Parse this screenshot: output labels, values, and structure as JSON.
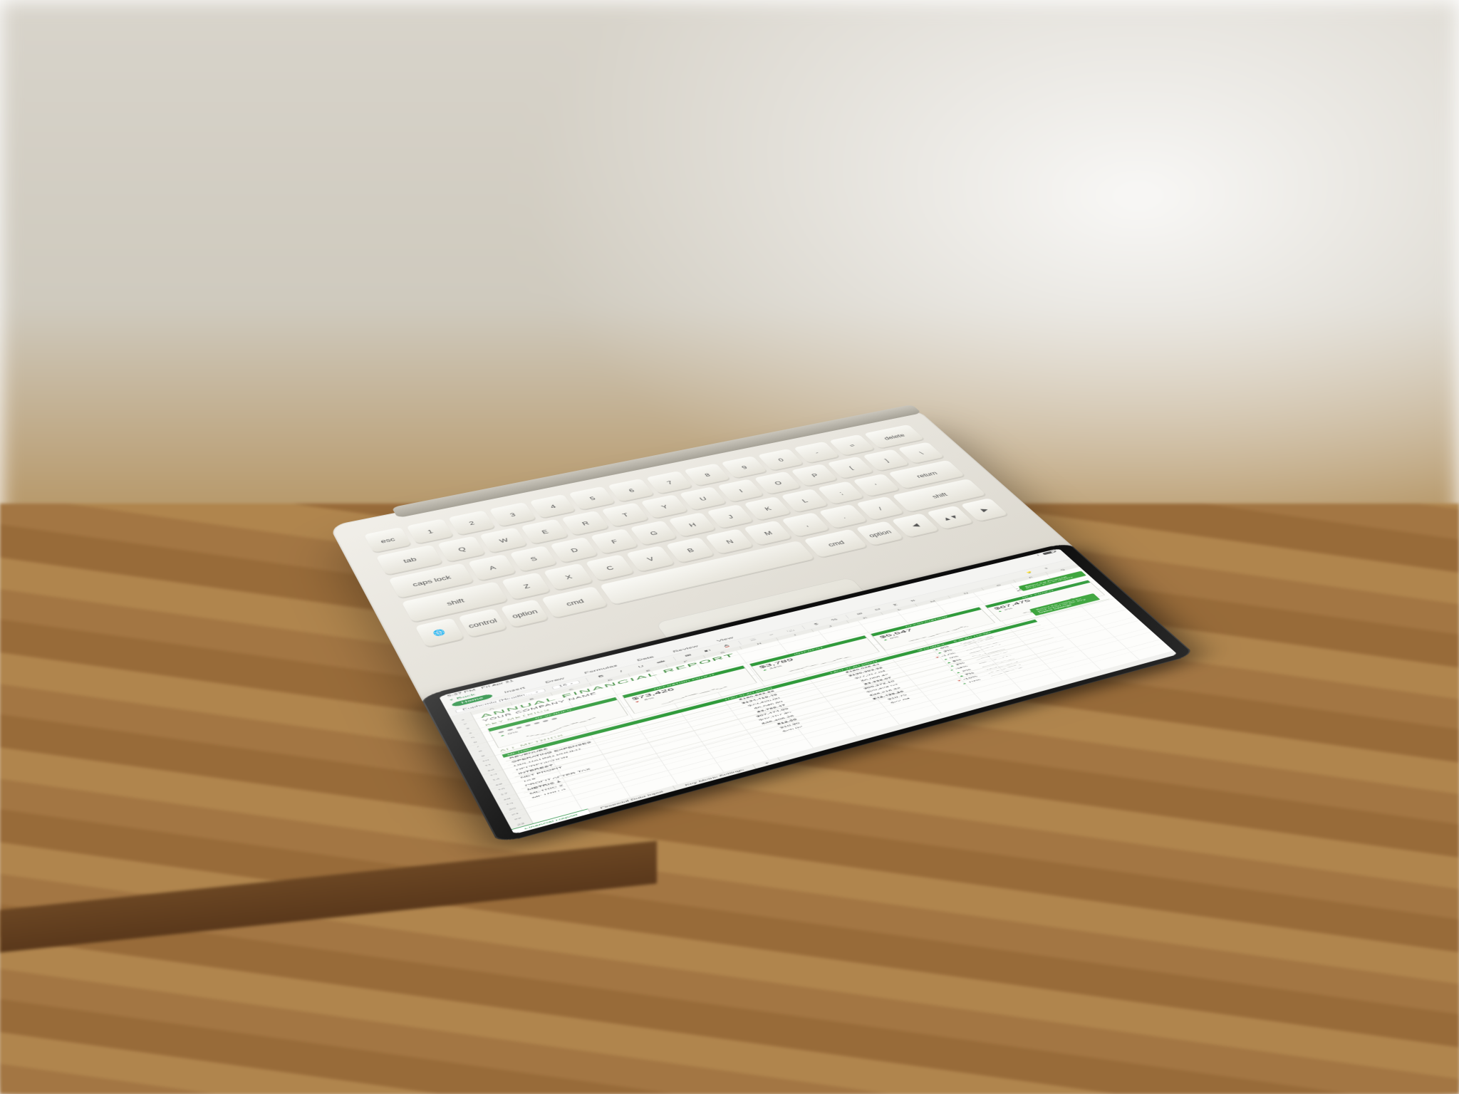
{
  "status": {
    "time": "5:37 PM",
    "date": "Fri Apr 21"
  },
  "titlebar": {
    "back": "Back"
  },
  "ribbon": {
    "tabs": [
      "Home",
      "Insert",
      "Draw",
      "Formulas",
      "Data",
      "Review",
      "View"
    ],
    "active": 0,
    "font_name": "Euphemia (Headin…",
    "font_size": "16"
  },
  "columns": [
    "A",
    "B",
    "C",
    "D",
    "E",
    "F",
    "G",
    "H",
    "I",
    "J",
    "K",
    "L",
    "M",
    "N",
    "O",
    "P",
    "Q"
  ],
  "report": {
    "title": "ANNUAL FINANCIAL REPORT",
    "company": "YOUR COMPANY NAME",
    "year": "2022",
    "section_key_metrics": "KEY METRICS",
    "section_all_metrics": "ALL METRICS",
    "callout_year": "Select the Financial Report year to display",
    "callout_metrics": "Select the metrics for your report on the Key Metric Settings"
  },
  "cards": [
    {
      "label": "REVENUES",
      "value": "●●●●●●●",
      "delta": "0%",
      "dir": "up",
      "dots": true
    },
    {
      "label": "OPERATING PROFIT",
      "value": "$73,426",
      "delta": "-6%",
      "dir": "down",
      "dots": false
    },
    {
      "label": "INTEREST",
      "value": "$3,789",
      "delta": "34%",
      "dir": "up",
      "dots": false
    },
    {
      "label": "DEPRECIATION",
      "value": "$5,547",
      "delta": "9%",
      "dir": "up",
      "dots": false
    },
    {
      "label": "NET PROFIT",
      "value": "$67,475",
      "delta": "2%",
      "dir": "up",
      "dots": false
    }
  ],
  "table": {
    "headers": {
      "metric": "METRIC",
      "this_year": "THIS YEAR (2022)",
      "last_year": "LAST YEAR (2021)",
      "pct": "% CHANGE",
      "trend": "5 YEAR TREND"
    },
    "rows": [
      {
        "metric": "REVENUES",
        "ty": "$180,583.88",
        "ly": "$180,026.64",
        "pct": "0%",
        "dir": "up"
      },
      {
        "metric": "OPERATING EXPENSES",
        "ty": "$134,415.46",
        "ly": "$130,383.32",
        "pct": "3%",
        "dir": "up"
      },
      {
        "metric": "OPERATING PROFIT",
        "ty": "$73,426.00",
        "ly": "$77,317.84",
        "pct": "-17%",
        "dir": "down"
      },
      {
        "metric": "DEPRECIATION",
        "ty": "$5,546.89",
        "ly": "$5,068.42",
        "pct": "9%",
        "dir": "up"
      },
      {
        "metric": "INTEREST",
        "ty": "$3,789.47",
        "ly": "$3,338.07",
        "pct": "5%",
        "dir": "up"
      },
      {
        "metric": "NET PROFIT",
        "ty": "$67,474.85",
        "ly": "$66,272.10",
        "pct": "2%",
        "dir": "up"
      },
      {
        "metric": "TAX",
        "ty": "$32,167.45",
        "ly": "$29,424.53",
        "pct": "34%",
        "dir": "up"
      },
      {
        "metric": "PROFIT AFTER TAX",
        "ty": "$35,406.26",
        "ly": "$48,216.32",
        "pct": "2%",
        "dir": "up"
      },
      {
        "metric": "METRIC 1",
        "ty": "$12.00",
        "ly": "$42,438.20",
        "pct": "7%",
        "dir": "up"
      },
      {
        "metric": "METRIC 2",
        "ty": "$18.96",
        "ly": "$18.75",
        "pct": "-16%",
        "dir": "down"
      },
      {
        "metric": "METRIC 3",
        "ty": "$26.02",
        "ly": "$22.84",
        "pct": "19%",
        "dir": "up"
      }
    ]
  },
  "sheet_tabs": [
    "Financial Report",
    "Financial Data Input",
    "Key Metric Settings"
  ],
  "active_sheet": 0
}
